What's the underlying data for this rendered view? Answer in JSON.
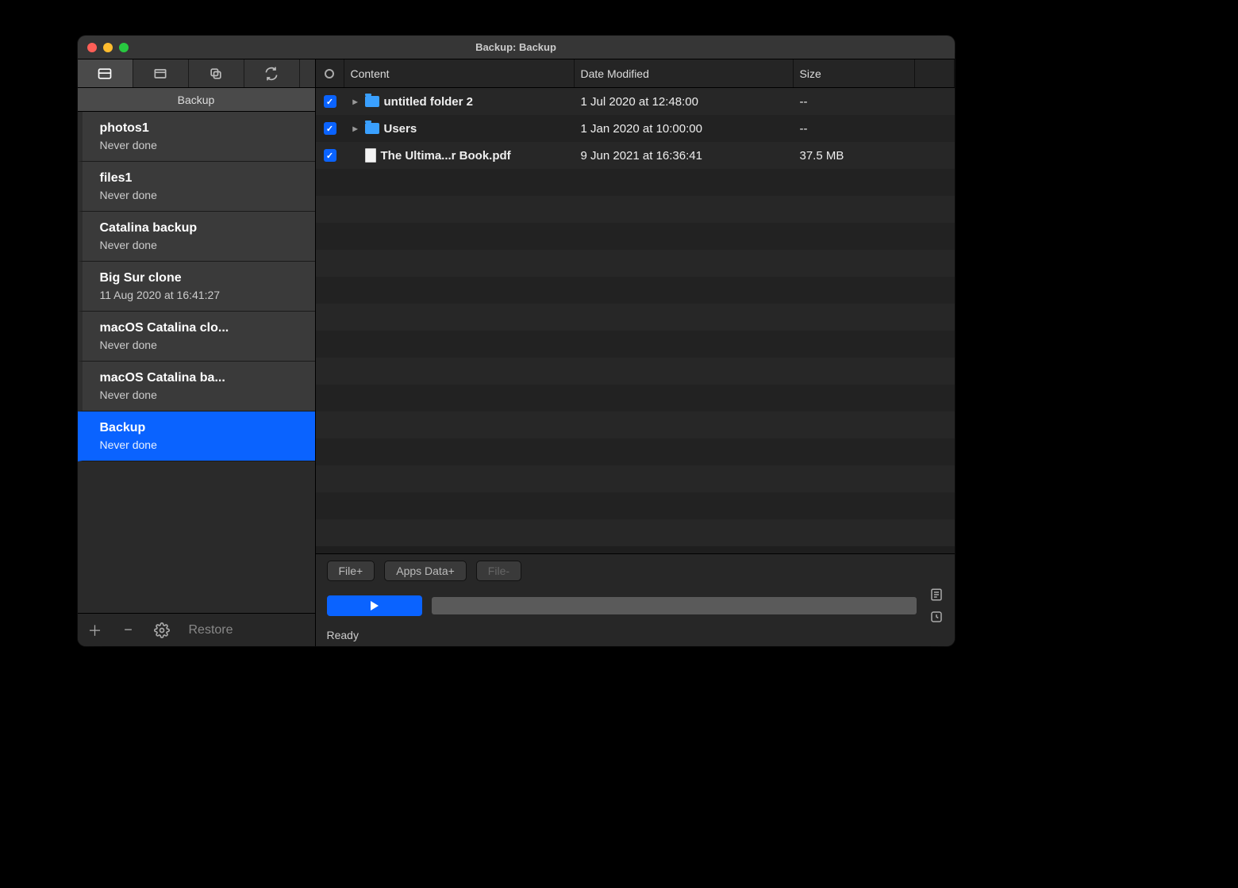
{
  "window": {
    "title": "Backup: Backup"
  },
  "sidebar": {
    "section_label": "Backup",
    "tasks": [
      {
        "name": "photos1",
        "status": "Never done"
      },
      {
        "name": "files1",
        "status": "Never done"
      },
      {
        "name": "Catalina backup",
        "status": "Never done"
      },
      {
        "name": "Big Sur clone",
        "status": "11 Aug 2020 at 16:41:27"
      },
      {
        "name": "macOS Catalina clo...",
        "status": "Never done"
      },
      {
        "name": "macOS Catalina ba...",
        "status": "Never done"
      },
      {
        "name": "Backup",
        "status": "Never done"
      }
    ],
    "restore_label": "Restore"
  },
  "columns": {
    "content": "Content",
    "date": "Date Modified",
    "size": "Size"
  },
  "files": [
    {
      "checked": true,
      "expandable": true,
      "kind": "folder",
      "name": "untitled folder 2",
      "date": "1 Jul 2020 at 12:48:00",
      "size": "--"
    },
    {
      "checked": true,
      "expandable": true,
      "kind": "folder",
      "name": "Users",
      "date": "1 Jan 2020 at 10:00:00",
      "size": "--"
    },
    {
      "checked": true,
      "expandable": false,
      "kind": "file",
      "name": "The Ultima...r Book.pdf",
      "date": "9 Jun 2021 at 16:36:41",
      "size": "37.5 MB"
    }
  ],
  "bottom": {
    "file_add": "File+",
    "apps_data": "Apps Data+",
    "file_remove": "File-",
    "status": "Ready"
  }
}
